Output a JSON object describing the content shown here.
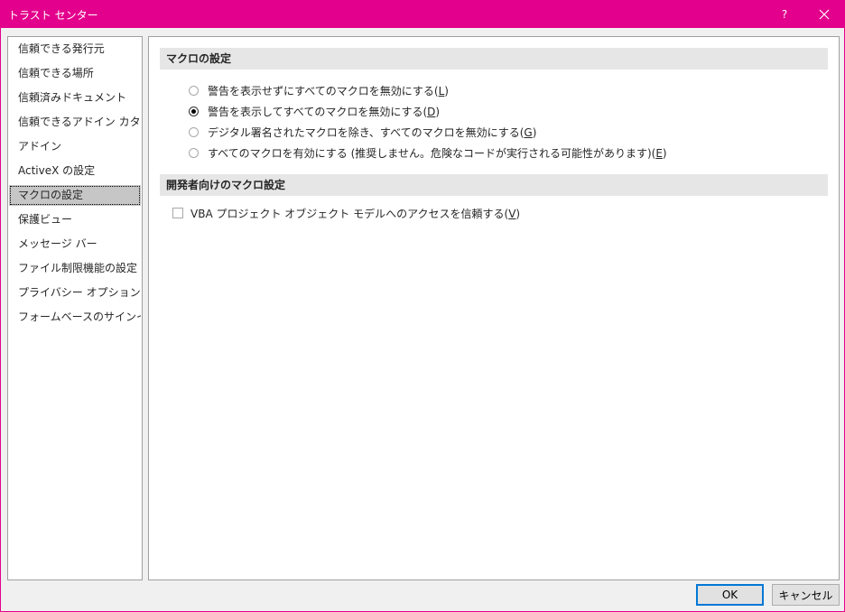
{
  "window": {
    "title": "トラスト センター",
    "help_label": "?",
    "accent_color": "#e3008c"
  },
  "sidebar": {
    "items": [
      {
        "label": "信頼できる発行元",
        "selected": false
      },
      {
        "label": "信頼できる場所",
        "selected": false
      },
      {
        "label": "信頼済みドキュメント",
        "selected": false
      },
      {
        "label": "信頼できるアドイン カタログ",
        "selected": false
      },
      {
        "label": "アドイン",
        "selected": false
      },
      {
        "label": "ActiveX の設定",
        "selected": false
      },
      {
        "label": "マクロの設定",
        "selected": true
      },
      {
        "label": "保護ビュー",
        "selected": false
      },
      {
        "label": "メッセージ バー",
        "selected": false
      },
      {
        "label": "ファイル制限機能の設定",
        "selected": false
      },
      {
        "label": "プライバシー オプション",
        "selected": false
      },
      {
        "label": "フォームベースのサインイン",
        "selected": false
      }
    ]
  },
  "macro_settings": {
    "header": "マクロの設定",
    "options": [
      {
        "label": "警告を表示せずにすべてのマクロを無効にする(",
        "key": "L",
        "suffix": ")",
        "checked": false
      },
      {
        "label": "警告を表示してすべてのマクロを無効にする(",
        "key": "D",
        "suffix": ")",
        "checked": true
      },
      {
        "label": "デジタル署名されたマクロを除き、すべてのマクロを無効にする(",
        "key": "G",
        "suffix": ")",
        "checked": false
      },
      {
        "label": "すべてのマクロを有効にする (推奨しません。危険なコードが実行される可能性があります)(",
        "key": "E",
        "suffix": ")",
        "checked": false
      }
    ]
  },
  "developer_settings": {
    "header": "開発者向けのマクロ設定",
    "checkbox_label": "VBA プロジェクト オブジェクト モデルへのアクセスを信頼する(",
    "checkbox_key": "V",
    "checkbox_suffix": ")",
    "checked": false
  },
  "buttons": {
    "ok": "OK",
    "cancel": "キャンセル"
  }
}
